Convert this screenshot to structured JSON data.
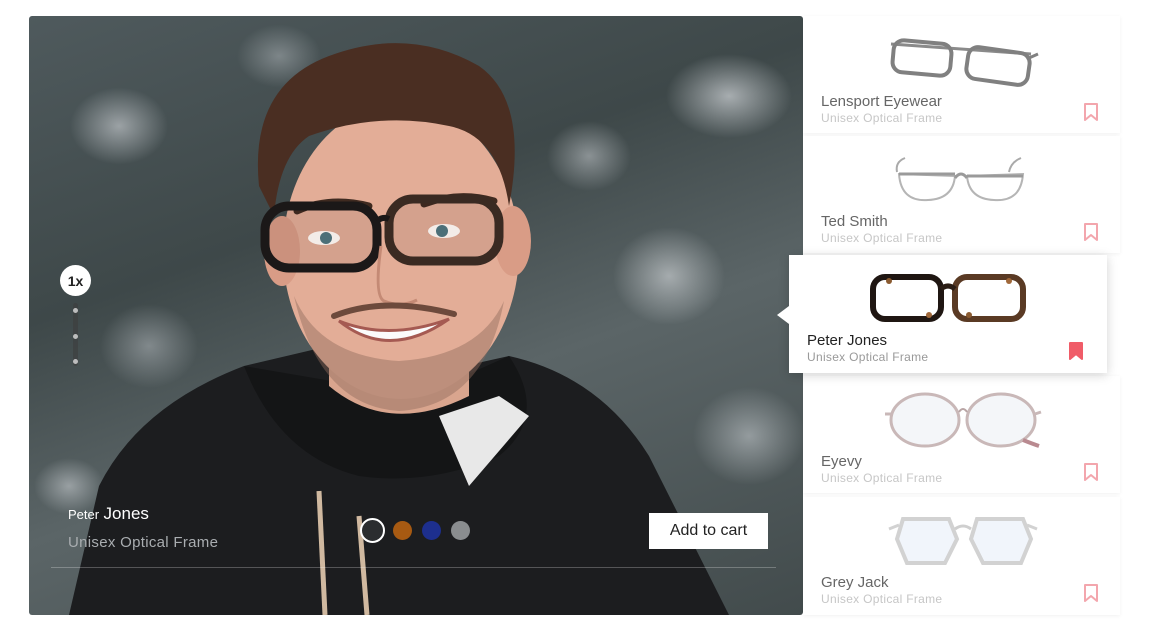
{
  "viewer": {
    "zoom_label": "1x",
    "product_first": "Peter",
    "product_last": "Jones",
    "product_type": "Unisex Optical Frame",
    "add_to_cart_label": "Add to cart",
    "colors": [
      "#2b2d2f",
      "#a75a12",
      "#1d2f8e",
      "#8a8d8f"
    ],
    "selected_color_index": 0
  },
  "products": [
    {
      "name": "Lensport Eyewear",
      "type": "Unisex Optical Frame",
      "bookmarked": false
    },
    {
      "name": "Ted Smith",
      "type": "Unisex Optical Frame",
      "bookmarked": false
    },
    {
      "name": "Peter Jones",
      "type": "Unisex Optical Frame",
      "bookmarked": true,
      "selected": true
    },
    {
      "name": "Eyevy",
      "type": "Unisex Optical Frame",
      "bookmarked": false
    },
    {
      "name": "Grey Jack",
      "type": "Unisex Optical Frame",
      "bookmarked": false
    }
  ],
  "theme": {
    "accent": "#f05c68",
    "bookmark_outline": "#f3a6ad"
  }
}
